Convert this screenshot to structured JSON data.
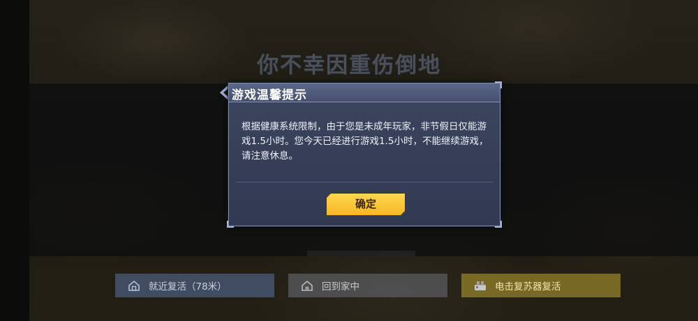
{
  "game": {
    "death_message": "你不幸因重伤倒地"
  },
  "dialog": {
    "title": "游戏温馨提示",
    "body": "根据健康系统限制，由于您是未成年玩家，非节假日仅能游戏1.5小时。您今天已经进行游戏1.5小时，不能继续游戏，请注意休息。",
    "confirm_label": "确定"
  },
  "bottom_actions": {
    "revive_near": {
      "label": "就近复活（78米）",
      "icon": "home-outline-icon"
    },
    "go_home": {
      "label": "回到家中",
      "icon": "home-icon"
    },
    "reviver": {
      "label": "电击复苏器复活",
      "icon": "defibrillator-icon"
    }
  },
  "colors": {
    "dialog_bg": "#3d4660",
    "dialog_border": "#7e8db3",
    "confirm_button": "#f5b824",
    "reviver_button": "#877628"
  }
}
